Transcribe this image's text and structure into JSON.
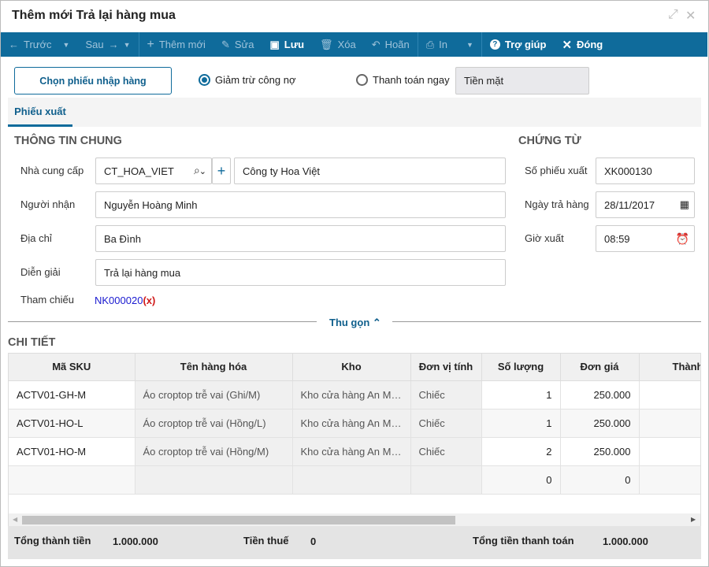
{
  "window": {
    "title": "Thêm mới Trả lại hàng mua"
  },
  "toolbar": {
    "prev": "Trước",
    "next": "Sau",
    "add": "Thêm mới",
    "edit": "Sửa",
    "save": "Lưu",
    "delete": "Xóa",
    "undo": "Hoãn",
    "print": "In",
    "help": "Trợ giúp",
    "close": "Đóng"
  },
  "top": {
    "choose_button": "Chọn phiếu nhập hàng",
    "radio_debt": "Giảm trừ công nợ",
    "radio_pay": "Thanh toán ngay",
    "pay_method": "Tiền mặt"
  },
  "tabs": [
    "Phiếu xuất"
  ],
  "general": {
    "title": "THÔNG TIN CHUNG",
    "supplier_label": "Nhà cung cấp",
    "supplier_code": "CT_HOA_VIET",
    "supplier_name": "Công ty Hoa Việt",
    "receiver_label": "Người nhận",
    "receiver": "Nguyễn Hoàng Minh",
    "address_label": "Địa chỉ",
    "address": "Ba Đình",
    "desc_label": "Diễn giải",
    "desc": "Trả lại hàng mua",
    "ref_label": "Tham chiếu",
    "ref": "NK000020",
    "ref_remove": "(x)"
  },
  "voucher": {
    "title": "CHỨNG TỪ",
    "no_label": "Số phiếu xuất",
    "no": "XK000130",
    "date_label": "Ngày trả hàng",
    "date": "28/11/2017",
    "time_label": "Giờ xuất",
    "time": "08:59"
  },
  "collapse": "Thu gọn",
  "detail": {
    "title": "CHI TIẾT",
    "columns": [
      "Mã SKU",
      "Tên hàng hóa",
      "Kho",
      "Đơn vị tính",
      "Số lượng",
      "Đơn giá",
      "Thành tiền"
    ],
    "rows": [
      [
        "ACTV01-GH-M",
        "Áo croptop trễ vai (Ghi/M)",
        "Kho cửa hàng An Mâ...",
        "Chiếc",
        "1",
        "250.000",
        ""
      ],
      [
        "ACTV01-HO-L",
        "Áo croptop trễ vai (Hồng/L)",
        "Kho cửa hàng An Mâ...",
        "Chiếc",
        "1",
        "250.000",
        ""
      ],
      [
        "ACTV01-HO-M",
        "Áo croptop trễ vai (Hồng/M)",
        "Kho cửa hàng An Mâ...",
        "Chiếc",
        "2",
        "250.000",
        ""
      ],
      [
        "",
        "",
        "",
        "",
        "0",
        "0",
        ""
      ]
    ]
  },
  "totals": {
    "subtotal_label": "Tổng thành tiền",
    "subtotal": "1.000.000",
    "tax_label": "Tiền thuế",
    "tax": "0",
    "total_label": "Tổng tiền thanh toán",
    "total": "1.000.000"
  }
}
